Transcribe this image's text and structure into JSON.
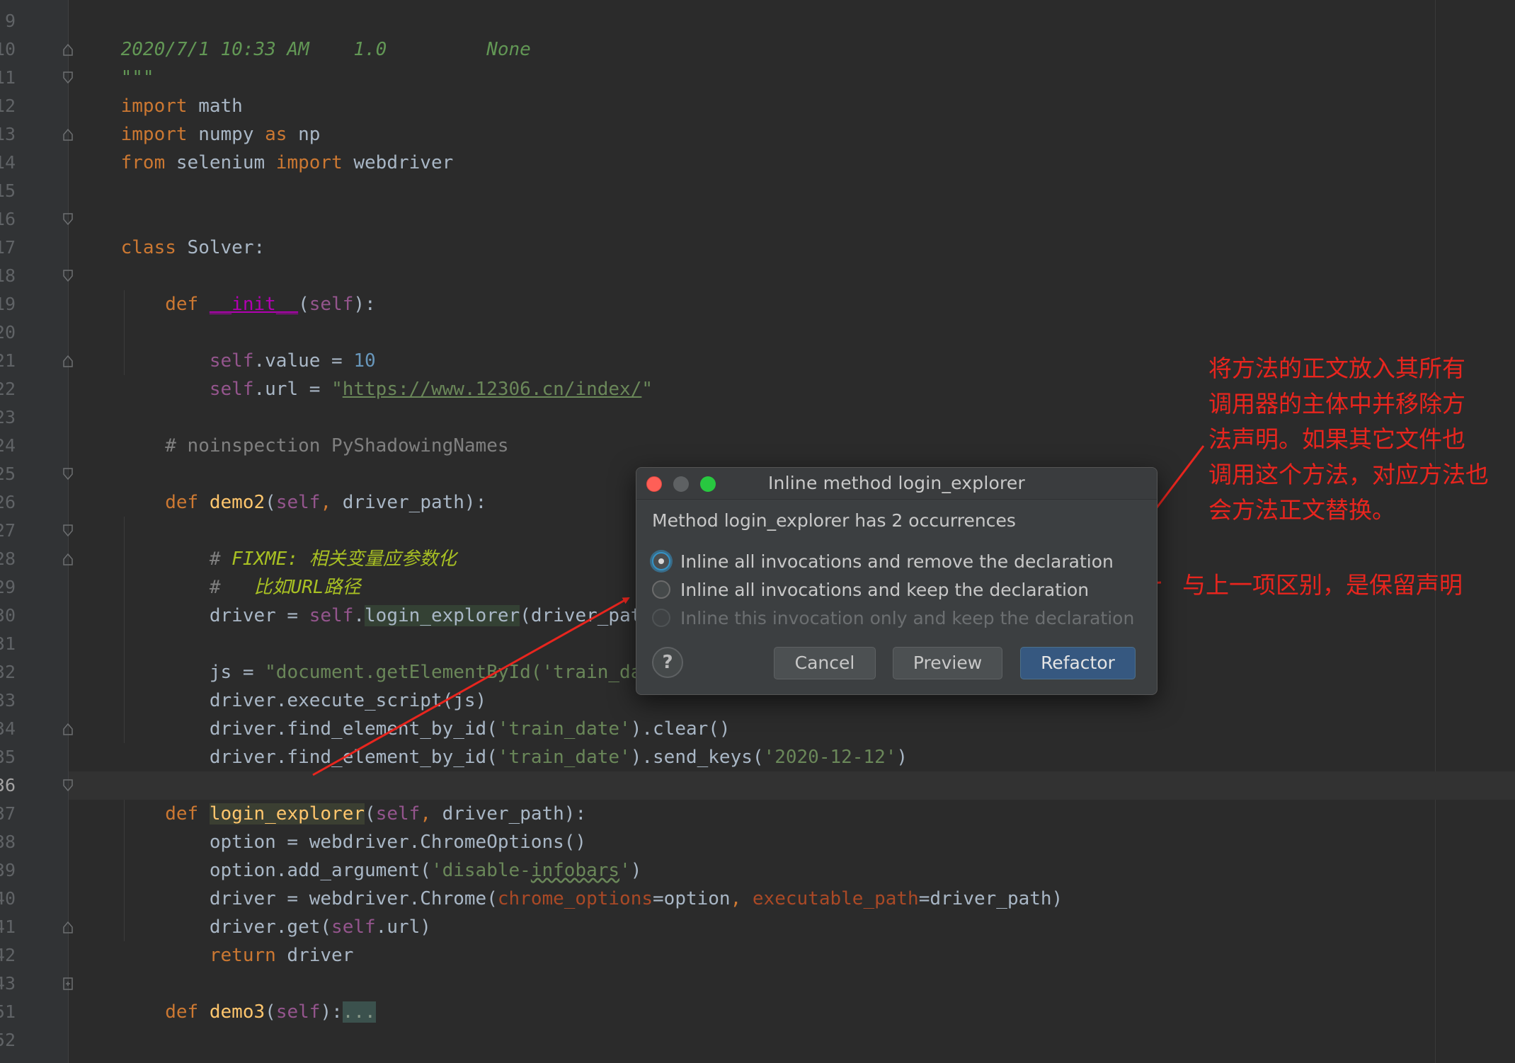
{
  "editor": {
    "line_numbers": [
      "9",
      "10",
      "11",
      "12",
      "13",
      "14",
      "15",
      "16",
      "17",
      "18",
      "19",
      "20",
      "21",
      "22",
      "23",
      "24",
      "25",
      "26",
      "27",
      "28",
      "29",
      "30",
      "31",
      "32",
      "33",
      "34",
      "35",
      "36",
      "37",
      "38",
      "39",
      "40",
      "41",
      "42",
      "43",
      "51",
      "52"
    ],
    "current_line": "36",
    "lines": {
      "l9": {
        "date": "2020/7/1 10:33 AM",
        "version": "1.0",
        "none": "None"
      },
      "l10": {
        "docstring_end": "\"\"\""
      },
      "l11": {
        "kw": "import",
        "rest": " math"
      },
      "l12": {
        "kw1": "import",
        "mid": " numpy ",
        "kw2": "as",
        "rest": " np"
      },
      "l13": {
        "kw1": "from",
        "mid": " selenium ",
        "kw2": "import",
        "rest": " webdriver"
      },
      "l16": {
        "kw": "class",
        "rest": " Solver:"
      },
      "l18": {
        "kw": "def",
        "fn": "__init__",
        "open": "(",
        "self": "self",
        "close": "):"
      },
      "l20": {
        "self": "self",
        "mid": ".value = ",
        "num": "10"
      },
      "l21": {
        "self": "self",
        "mid": ".url = ",
        "q1": "\"",
        "url": "https://www.12306.cn/index/",
        "q2": "\""
      },
      "l23": {
        "comment": "# noinspection PyShadowingNames"
      },
      "l25": {
        "kw": "def",
        "fn": "demo2",
        "open": "(",
        "self": "self",
        "comma": ",",
        "rest": " driver_path):"
      },
      "l27": {
        "hash": "# ",
        "todo": "FIXME: 相关变量应参数化"
      },
      "l28": {
        "hash": "#   ",
        "todo": "比如URL路径"
      },
      "l29": {
        "pre": "driver = ",
        "self": "self",
        "dot": ".",
        "usage": "login_explorer",
        "rest": "(driver_path)"
      },
      "l31": {
        "pre": "js = ",
        "str": "\"document.getElementById('train_date"
      },
      "l32": {
        "text": "driver.execute_script(js)"
      },
      "l33": {
        "pre": "driver.find_element_by_id(",
        "str": "'train_date'",
        "rest": ").clear()"
      },
      "l34": {
        "pre": "driver.find_element_by_id(",
        "str": "'train_date'",
        "mid": ").send_keys(",
        "str2": "'2020-12-12'",
        "rest": ")"
      },
      "l36": {
        "kw": "def",
        "fn": "login_explorer",
        "open": "(",
        "self": "self",
        "comma": ",",
        "rest": " driver_path):"
      },
      "l37": {
        "text": "option = webdriver.ChromeOptions()"
      },
      "l38": {
        "pre": "option.add_argument(",
        "str1": "'disable-",
        "str_typo": "infobars",
        "str2": "'",
        "rest": ")"
      },
      "l39": {
        "pre": "driver = webdriver.Chrome(",
        "p1": "chrome_options",
        "mid1": "=option",
        "comma": ",",
        "sp": " ",
        "p2": "executable_path",
        "rest": "=driver_path)"
      },
      "l40": {
        "pre": "driver.get(",
        "self": "self",
        "rest": ".url)"
      },
      "l41": {
        "kw": "return",
        "rest": " driver"
      },
      "l43": {
        "kw": "def",
        "fn": "demo3",
        "open": "(",
        "self": "self",
        "close": "):",
        "folded": "..."
      }
    }
  },
  "dialog": {
    "title": "Inline method login_explorer",
    "message": "Method login_explorer has 2 occurrences",
    "options": [
      {
        "label": "Inline all invocations and remove the declaration",
        "selected": true,
        "enabled": true
      },
      {
        "label": "Inline all invocations and keep the declaration",
        "selected": false,
        "enabled": true
      },
      {
        "label": "Inline this invocation only and keep the declaration",
        "selected": false,
        "enabled": false
      }
    ],
    "help": "?",
    "buttons": {
      "cancel": "Cancel",
      "preview": "Preview",
      "refactor": "Refactor"
    }
  },
  "annotations": {
    "note1": [
      "将方法的正文放入其所有",
      "调用器的主体中并移除方",
      "法声明。如果其它文件也",
      "调用这个方法，对应方法也",
      "会方法正文替换。"
    ],
    "note2": "与上一项区别，是保留声明"
  },
  "colors": {
    "editor_bg": "#2b2b2b",
    "keyword": "#cc7832",
    "string": "#6a8759",
    "annotation_red": "#e8251e",
    "primary_button": "#365880"
  }
}
